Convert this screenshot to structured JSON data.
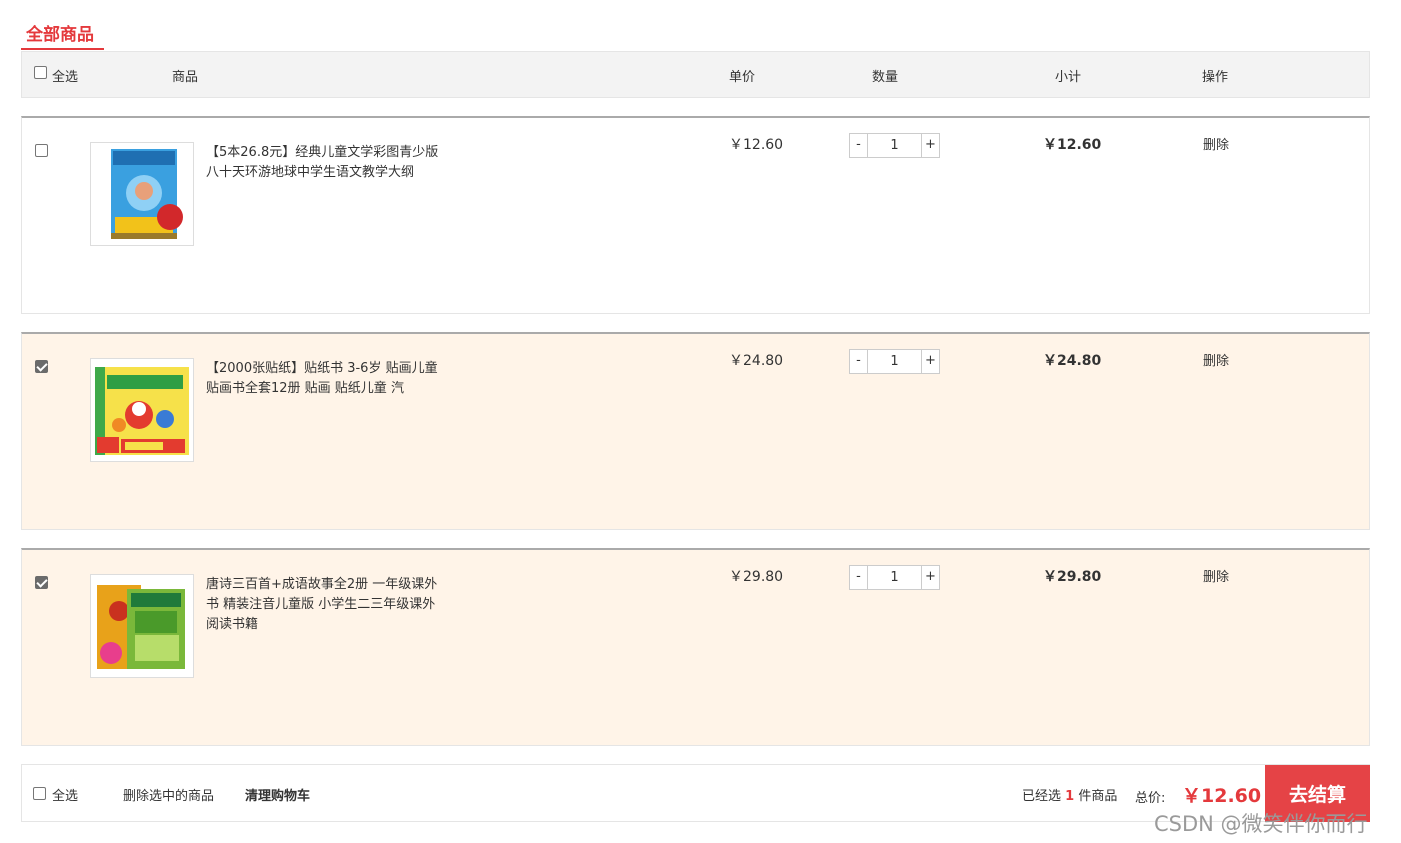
{
  "tab": {
    "title": "全部商品"
  },
  "table_header": {
    "select_all": "全选",
    "product": "商品",
    "unit_price": "单价",
    "quantity": "数量",
    "subtotal": "小计",
    "action": "操作"
  },
  "items": [
    {
      "checked": false,
      "name": "【5本26.8元】经典儿童文学彩图青少版八十天环游地球中学生语文教学大纲",
      "price": "￥12.60",
      "qty_minus": "-",
      "qty": "1",
      "qty_plus": "+",
      "subtotal": "￥12.60",
      "delete": "删除"
    },
    {
      "checked": true,
      "name": "【2000张贴纸】贴纸书 3-6岁 贴画儿童 贴画书全套12册 贴画 贴纸儿童 汽",
      "price": "￥24.80",
      "qty_minus": "-",
      "qty": "1",
      "qty_plus": "+",
      "subtotal": "￥24.80",
      "delete": "删除"
    },
    {
      "checked": true,
      "name": "唐诗三百首+成语故事全2册 一年级课外书 精装注音儿童版 小学生二三年级课外阅读书籍",
      "price": "￥29.80",
      "qty_minus": "-",
      "qty": "1",
      "qty_plus": "+",
      "subtotal": "￥29.80",
      "delete": "删除"
    }
  ],
  "footer": {
    "select_all": "全选",
    "delete_selected": "删除选中的商品",
    "clear_cart": "清理购物车",
    "selected_prefix": "已经选",
    "selected_count": "1",
    "selected_suffix": "件商品",
    "total_label": "总价:",
    "total_value": "￥12.60",
    "checkout": "去结算"
  },
  "watermark": "CSDN @微笑伴你而行",
  "colors": {
    "accent": "#e4393c",
    "selected_row_bg": "#fff4e8",
    "header_bg": "#f3f3f3"
  }
}
